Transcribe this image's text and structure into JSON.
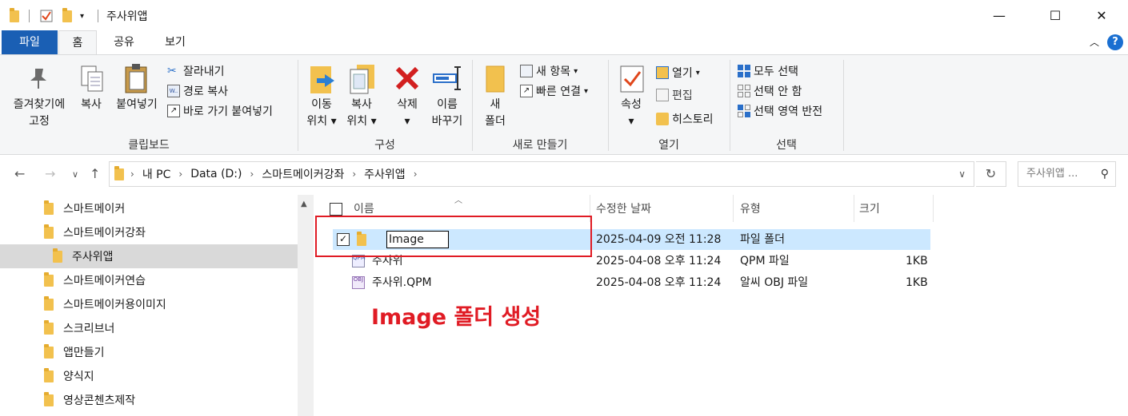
{
  "window": {
    "title": "주사위앱",
    "minimize": "—",
    "maximize": "☐",
    "close": "✕"
  },
  "ribbon_tabs": [
    "파일",
    "홈",
    "공유",
    "보기"
  ],
  "ribbon": {
    "clipboard": {
      "label": "클립보드",
      "pin_line1": "즐겨찾기에",
      "pin_line2": "고정",
      "copy": "복사",
      "paste": "붙여넣기",
      "cut": "잘라내기",
      "copy_path": "경로 복사",
      "paste_shortcut": "바로 가기 붙여넣기"
    },
    "organize": {
      "label": "구성",
      "move_line1": "이동",
      "move_line2": "위치",
      "copy_line1": "복사",
      "copy_line2": "위치",
      "delete": "삭제",
      "rename_line1": "이름",
      "rename_line2": "바꾸기"
    },
    "new": {
      "label": "새로 만들기",
      "folder_line1": "새",
      "folder_line2": "폴더",
      "new_item": "새 항목",
      "easy_access": "빠른 연결"
    },
    "open": {
      "label": "열기",
      "properties": "속성",
      "open": "열기",
      "edit": "편집",
      "history": "히스토리"
    },
    "select": {
      "label": "선택",
      "select_all": "모두 선택",
      "select_none": "선택 안 함",
      "invert": "선택 영역 반전"
    }
  },
  "address": {
    "crumbs": [
      "내 PC",
      "Data (D:)",
      "스마트메이커강좌",
      "주사위앱"
    ],
    "search_placeholder": "주사위앱 ..."
  },
  "nav_items": [
    "스마트메이커",
    "스마트메이커강좌",
    "주사위앱",
    "스마트메이커연습",
    "스마트메이커용이미지",
    "스크리브너",
    "앱만들기",
    "양식지",
    "영상콘첸츠제작"
  ],
  "columns": {
    "name": "이름",
    "modified": "수정한 날짜",
    "type": "유형",
    "size": "크기"
  },
  "files": [
    {
      "name": "Image",
      "modified": "2025-04-09 오전 11:28",
      "type": "파일 폴더",
      "size": ""
    },
    {
      "name": "주사위",
      "modified": "2025-04-08 오후 11:24",
      "type": "QPM 파일",
      "size": "1KB"
    },
    {
      "name": "주사위.QPM",
      "modified": "2025-04-08 오후 11:24",
      "type": "알씨 OBJ 파일",
      "size": "1KB"
    }
  ],
  "annotation": "Image 폴더 생성",
  "colors": {
    "accent": "#1a5fb4",
    "selection": "#cce8ff",
    "annotation": "#e01b24"
  }
}
